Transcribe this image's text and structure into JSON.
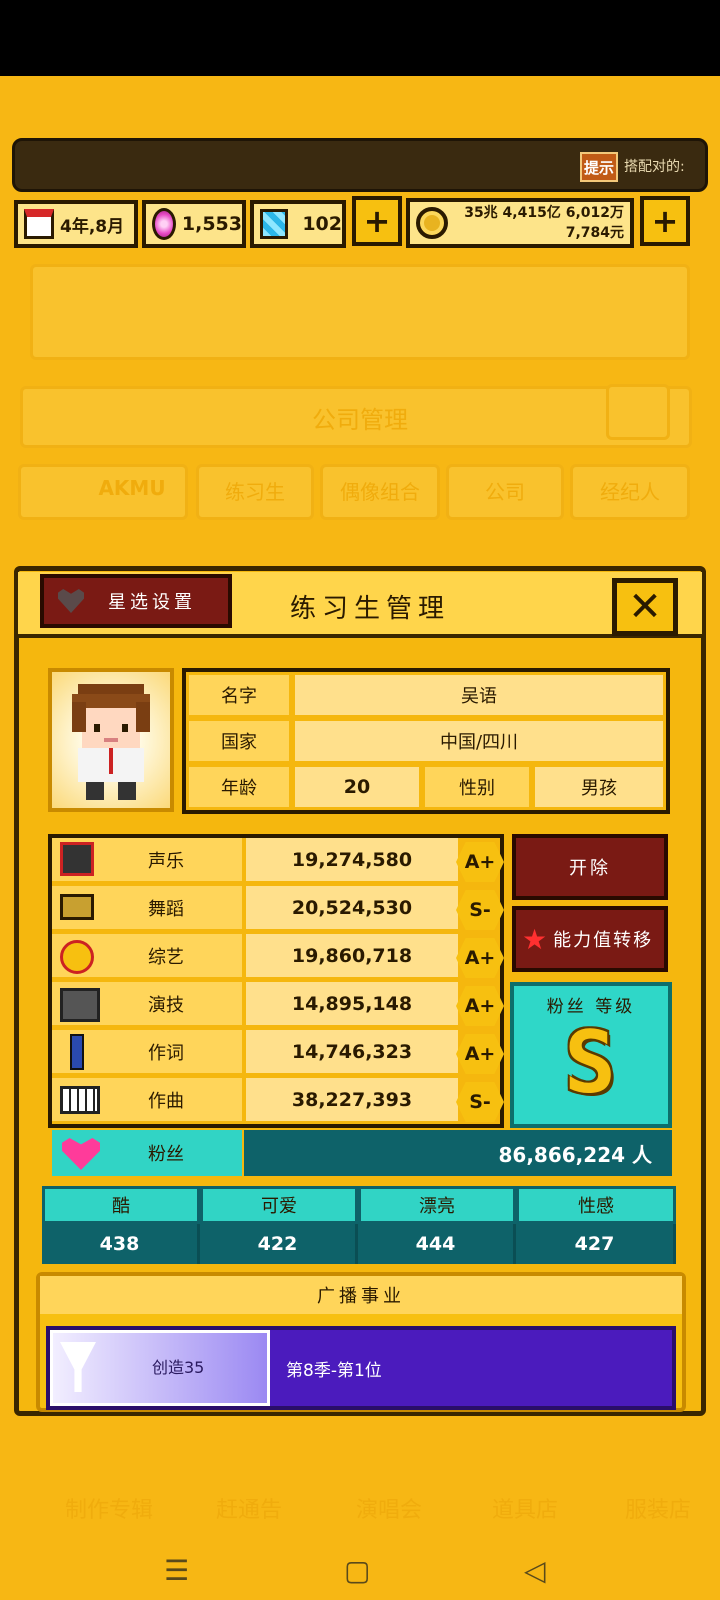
{
  "top": {
    "tip_button": "提示",
    "tip_text": "搭配对的:"
  },
  "resources": {
    "date": "4年,8月",
    "gems": "1,553",
    "diamonds": "102",
    "money_line1": "35兆 4,415亿 6,012万",
    "money_line2": "7,784元",
    "plus": "+"
  },
  "background": {
    "company_title": "公司管理",
    "tabs": [
      "AKMU",
      "练习生",
      "偶像组合",
      "公司",
      "经纪人"
    ],
    "bottom_tabs": [
      "制作专辑",
      "赶通告",
      "演唱会",
      "道具店",
      "服装店"
    ]
  },
  "panel": {
    "title": "练习生管理",
    "star_button": "星选设置",
    "close": "✕"
  },
  "profile": {
    "name_label": "名字",
    "name_value": "吴语",
    "country_label": "国家",
    "country_value": "中国/四川",
    "age_label": "年龄",
    "age_value": "20",
    "gender_label": "性别",
    "gender_value": "男孩"
  },
  "stats": [
    {
      "label": "声乐",
      "value": "19,274,580",
      "grade": "A+",
      "icon": "microphone-icon"
    },
    {
      "label": "舞蹈",
      "value": "20,524,530",
      "grade": "S-",
      "icon": "shoe-icon"
    },
    {
      "label": "综艺",
      "value": "19,860,718",
      "grade": "A+",
      "icon": "laugh-icon"
    },
    {
      "label": "演技",
      "value": "14,895,148",
      "grade": "A+",
      "icon": "camera-icon"
    },
    {
      "label": "作词",
      "value": "14,746,323",
      "grade": "A+",
      "icon": "pen-icon"
    },
    {
      "label": "作曲",
      "value": "38,227,393",
      "grade": "S-",
      "icon": "piano-icon"
    }
  ],
  "fans": {
    "label": "粉丝",
    "value": "86,866,224 人",
    "grade_title": "粉丝 等级",
    "grade": "S"
  },
  "actions": {
    "dismiss": "开除",
    "transfer": "能力值转移"
  },
  "attributes": [
    {
      "label": "酷",
      "value": "438"
    },
    {
      "label": "可爱",
      "value": "422"
    },
    {
      "label": "漂亮",
      "value": "444"
    },
    {
      "label": "性感",
      "value": "427"
    }
  ],
  "broadcast": {
    "title": "广播事业",
    "card": "创造35",
    "rank": "第8季-第1位"
  },
  "nav": {
    "menu": "☰",
    "home": "▢",
    "back": "◁"
  }
}
